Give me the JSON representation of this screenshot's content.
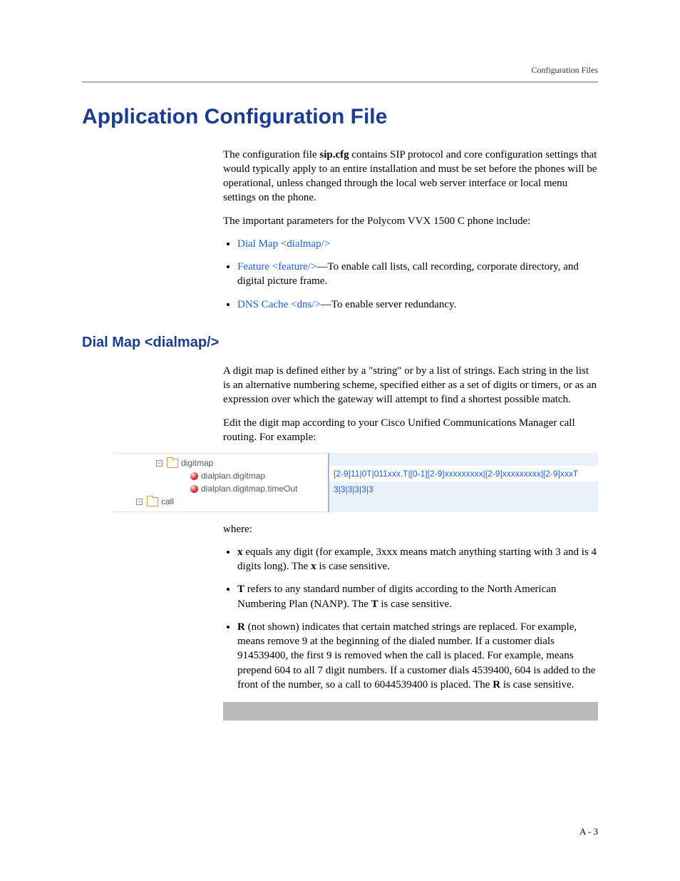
{
  "header": {
    "section_label": "Configuration Files"
  },
  "titles": {
    "main": "Application Configuration File",
    "dialmap": "Dial Map <dialmap/>"
  },
  "intro": {
    "p1a": "The configuration file ",
    "p1_file": "sip.cfg",
    "p1b": " contains SIP protocol and core configuration settings that would typically apply to an entire installation and must be set before the phones will be operational, unless changed through the local web server interface or local menu settings on the phone.",
    "p2": "The important parameters for the Polycom VVX 1500 C phone include:"
  },
  "param_list": {
    "item1_link": "Dial Map <dialmap/>",
    "item2_link": "Feature <feature/>",
    "item2_rest": "—To enable call lists, call recording, corporate directory, and digital picture frame.",
    "item3_link": "DNS Cache <dns/>",
    "item3_rest": "—To enable server redundancy."
  },
  "dialmap_body": {
    "p1": "A digit map is defined either by a \"string\" or by a list of strings. Each string in the list is an alternative numbering scheme, specified either as a set of digits or timers, or as an expression over which the gateway will attempt to find a shortest possible match.",
    "p2": "Edit the digit map according to your Cisco Unified Communications Manager call routing. For example:"
  },
  "tree": {
    "n1": "digitmap",
    "n2": "dialplan.digitmap",
    "n3": "dialplan.digitmap.timeOut",
    "n4": "call"
  },
  "values": {
    "row1": "[2-9]11|0T|011xxx.T|[0-1][2-9]xxxxxxxxx|[2-9]xxxxxxxxx|[2-9]xxxT",
    "row2": "3|3|3|3|3|3"
  },
  "where_label": "where:",
  "where_list": {
    "i1a": "x",
    "i1b": " equals any digit (for example, 3xxx means match anything starting with 3 and is 4 digits long). The ",
    "i1c": "x",
    "i1d": " is case sensitive.",
    "i2a": "T",
    "i2b": " refers to any standard number of digits according to the North American Numbering Plan (NANP). The ",
    "i2c": "T",
    "i2d": " is case sensitive.",
    "i3a": "R",
    "i3b": " (not shown) indicates that certain matched strings are replaced. For example, ",
    "i3c": " means remove 9 at the beginning of the dialed number. If a customer dials 914539400, the first 9 is removed when the call is placed. For example, ",
    "i3d": " means prepend 604 to all 7 digit numbers. If a customer dials 4539400, 604 is added to the front of the number, so a call to 6044539400 is placed. The ",
    "i3e": "R",
    "i3f": " is case sensitive."
  },
  "footer": {
    "page": "A - 3"
  }
}
